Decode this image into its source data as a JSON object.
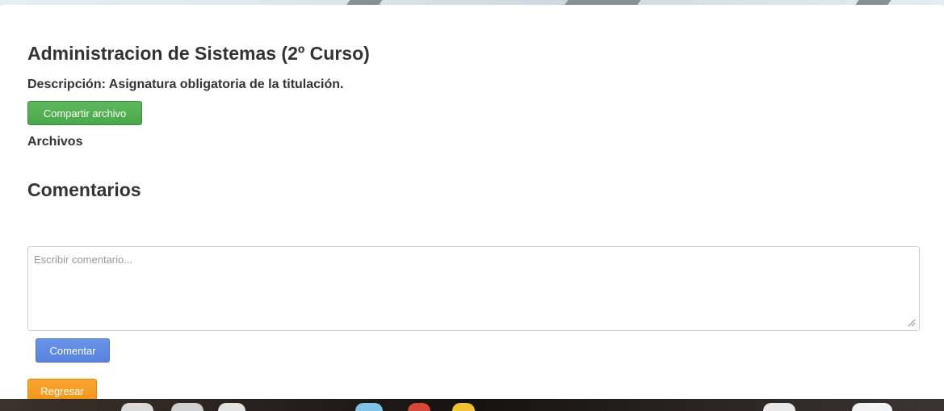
{
  "subject": {
    "title": "Administracion de Sistemas (2º Curso)",
    "description": "Descripción: Asignatura obligatoria de la titulación."
  },
  "actions": {
    "share_file_label": "Compartir archivo"
  },
  "files": {
    "heading": "Archivos"
  },
  "comments": {
    "heading": "Comentarios",
    "input_placeholder": "Escribir comentario...",
    "input_value": "",
    "submit_label": "Comentar"
  },
  "navigation": {
    "back_label": "Regresar"
  },
  "colors": {
    "success": "#5cb85c",
    "primary": "#5784e0",
    "warning": "#f39418",
    "text": "#333333"
  },
  "icons": {
    "resize_handle": "resize-grip-icon"
  }
}
